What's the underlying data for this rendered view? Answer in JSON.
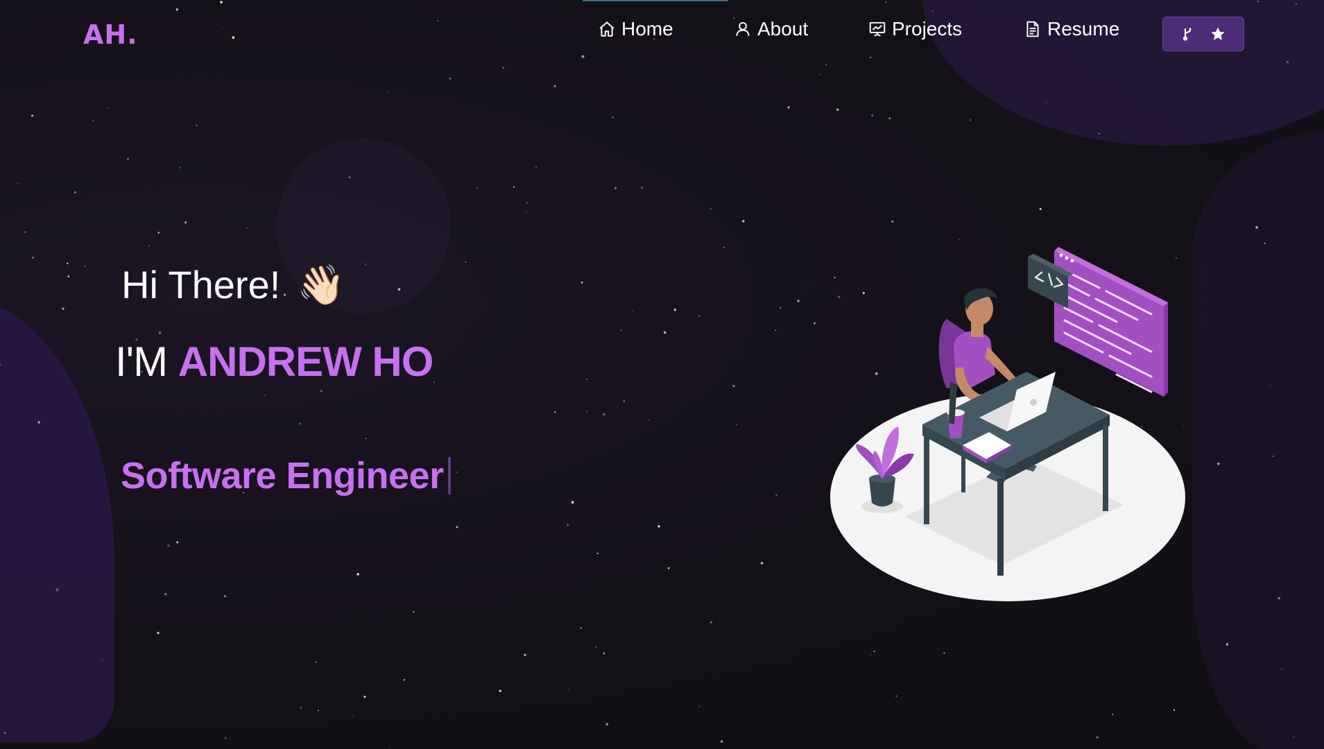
{
  "brand": {
    "logo": "AH."
  },
  "nav": {
    "items": [
      {
        "label": "Home",
        "icon": "home-icon"
      },
      {
        "label": "About",
        "icon": "user-icon"
      },
      {
        "label": "Projects",
        "icon": "presentation-icon"
      },
      {
        "label": "Resume",
        "icon": "document-icon"
      }
    ],
    "github_button": {
      "icons": [
        "git-fork-icon",
        "star-icon"
      ]
    }
  },
  "hero": {
    "greeting": "Hi There!",
    "wave_emoji": "👋🏻",
    "intro_prefix": "I'M",
    "name": "ANDREW HO",
    "role": "Software Engineer"
  },
  "colors": {
    "accent": "#c770f0",
    "background": "#16121c",
    "button": "#4a2d76"
  }
}
